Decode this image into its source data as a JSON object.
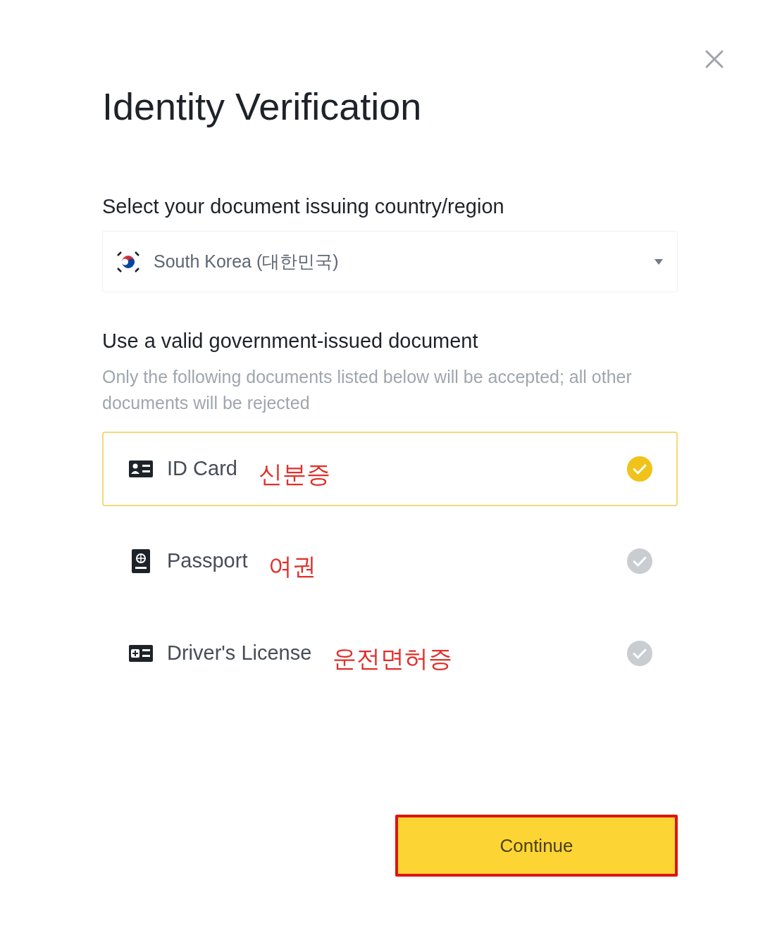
{
  "dialog": {
    "title": "Identity Verification"
  },
  "country": {
    "label": "Select your document issuing country/region",
    "value": "South Korea (대한민국)"
  },
  "documents": {
    "heading": "Use a valid government-issued document",
    "note": "Only the following documents listed below will be accepted; all other documents will be rejected",
    "options": [
      {
        "kind": "id-card",
        "label": "ID Card",
        "annotation": "신분증",
        "selected": true
      },
      {
        "kind": "passport",
        "label": "Passport",
        "annotation": "여권",
        "selected": false
      },
      {
        "kind": "license",
        "label": "Driver's License",
        "annotation": "운전면허증",
        "selected": false
      }
    ]
  },
  "continue_button": {
    "label": "Continue",
    "highlighted": true
  }
}
